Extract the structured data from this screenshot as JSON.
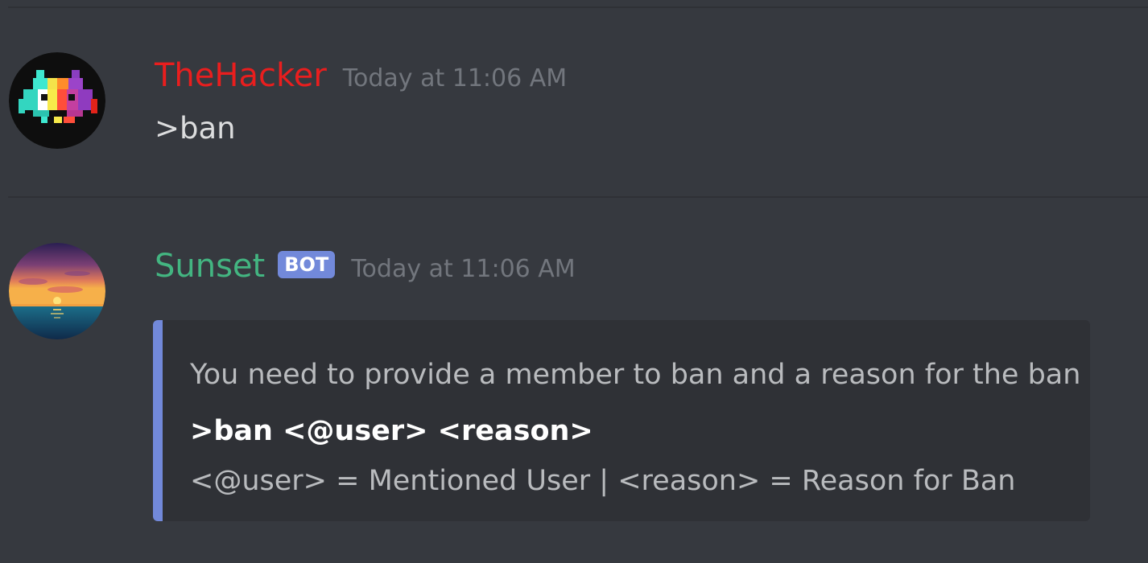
{
  "messages": [
    {
      "username": "TheHacker",
      "username_color": "#e91e1e",
      "timestamp": "Today at 11:06 AM",
      "content": ">ban",
      "avatar": "space-invader-avatar"
    },
    {
      "username": "Sunset",
      "username_color": "#43b581",
      "bot_tag": "BOT",
      "timestamp": "Today at 11:06 AM",
      "avatar": "sunset-avatar",
      "embed": {
        "accent_color": "#7289da",
        "description": "You need to provide a member to ban and a reason for the ban",
        "usage": ">ban <@user> <reason>",
        "legend": "<@user> = Mentioned User | <reason> = Reason for Ban"
      }
    }
  ]
}
